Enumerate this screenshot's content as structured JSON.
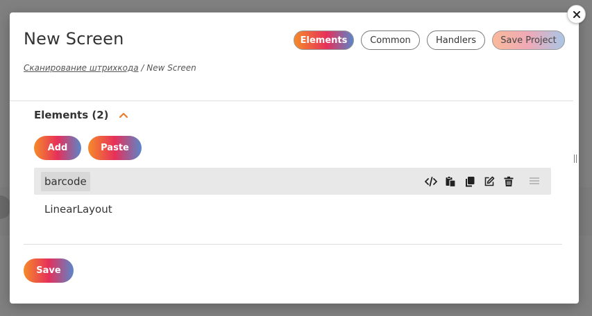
{
  "modal": {
    "title": "New Screen",
    "tabs": [
      {
        "label": "Elements",
        "active": true
      },
      {
        "label": "Common",
        "active": false
      },
      {
        "label": "Handlers",
        "active": false
      }
    ],
    "save_project_label": "Save Project",
    "breadcrumb": {
      "link": "Сканирование штрихкода",
      "separator": " / ",
      "current": "New Screen"
    }
  },
  "elements": {
    "header": "Elements (2)",
    "add_label": "Add",
    "paste_label": "Paste",
    "items": [
      {
        "label": "barcode",
        "selected": true
      },
      {
        "label": "LinearLayout",
        "selected": false
      }
    ]
  },
  "footer": {
    "save_label": "Save"
  },
  "colors": {
    "accent_orange": "#f58a2a",
    "accent_red": "#e6305a",
    "accent_blue": "#5b86c9",
    "chevron": "#f07a2a",
    "selected_row": "#e8e8e8"
  },
  "icons": [
    "close-icon",
    "chevron-up-icon",
    "code-icon",
    "paste-icon",
    "copy-icon",
    "edit-icon",
    "trash-icon",
    "drag-handle-icon"
  ]
}
